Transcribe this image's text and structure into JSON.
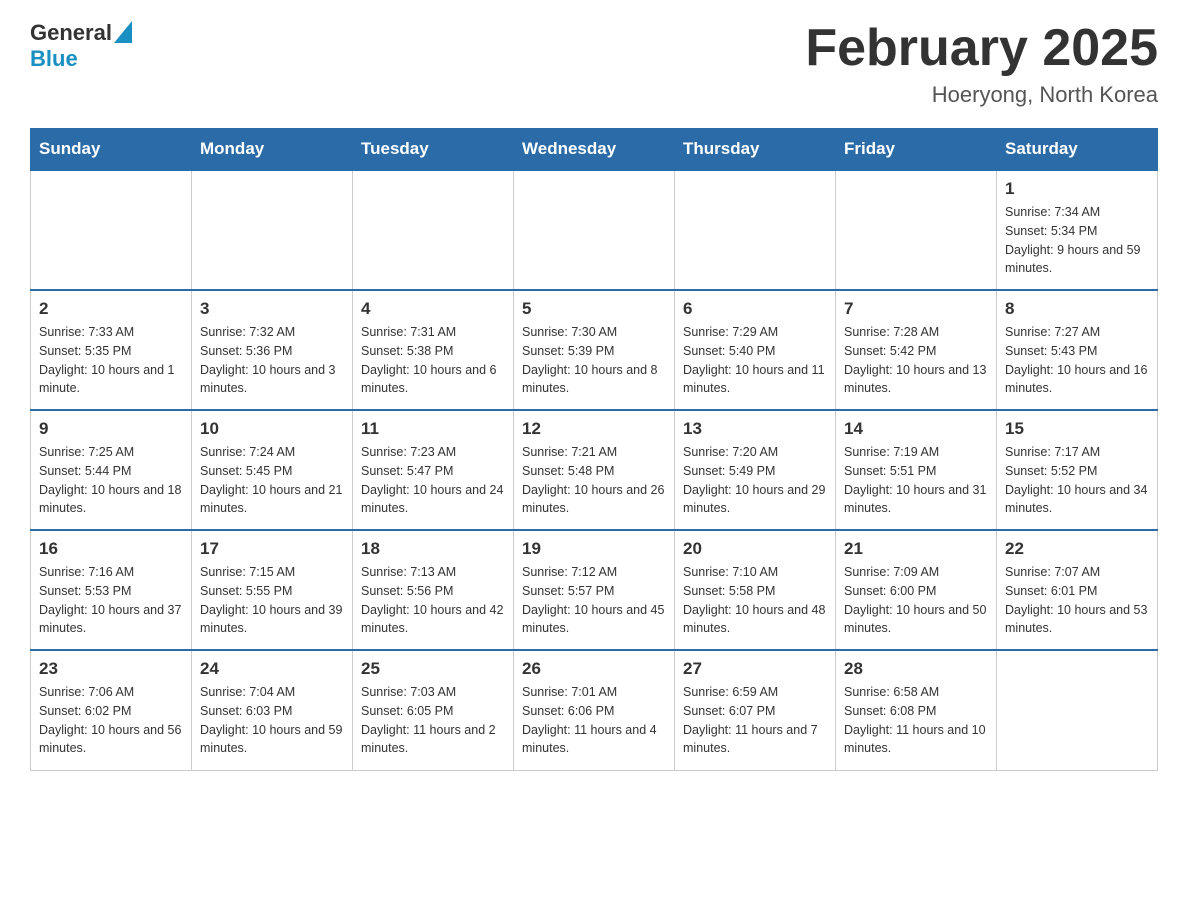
{
  "header": {
    "logo_general": "General",
    "logo_blue": "Blue",
    "title": "February 2025",
    "subtitle": "Hoeryong, North Korea"
  },
  "weekdays": [
    "Sunday",
    "Monday",
    "Tuesday",
    "Wednesday",
    "Thursday",
    "Friday",
    "Saturday"
  ],
  "weeks": [
    [
      {
        "day": "",
        "info": ""
      },
      {
        "day": "",
        "info": ""
      },
      {
        "day": "",
        "info": ""
      },
      {
        "day": "",
        "info": ""
      },
      {
        "day": "",
        "info": ""
      },
      {
        "day": "",
        "info": ""
      },
      {
        "day": "1",
        "info": "Sunrise: 7:34 AM\nSunset: 5:34 PM\nDaylight: 9 hours and 59 minutes."
      }
    ],
    [
      {
        "day": "2",
        "info": "Sunrise: 7:33 AM\nSunset: 5:35 PM\nDaylight: 10 hours and 1 minute."
      },
      {
        "day": "3",
        "info": "Sunrise: 7:32 AM\nSunset: 5:36 PM\nDaylight: 10 hours and 3 minutes."
      },
      {
        "day": "4",
        "info": "Sunrise: 7:31 AM\nSunset: 5:38 PM\nDaylight: 10 hours and 6 minutes."
      },
      {
        "day": "5",
        "info": "Sunrise: 7:30 AM\nSunset: 5:39 PM\nDaylight: 10 hours and 8 minutes."
      },
      {
        "day": "6",
        "info": "Sunrise: 7:29 AM\nSunset: 5:40 PM\nDaylight: 10 hours and 11 minutes."
      },
      {
        "day": "7",
        "info": "Sunrise: 7:28 AM\nSunset: 5:42 PM\nDaylight: 10 hours and 13 minutes."
      },
      {
        "day": "8",
        "info": "Sunrise: 7:27 AM\nSunset: 5:43 PM\nDaylight: 10 hours and 16 minutes."
      }
    ],
    [
      {
        "day": "9",
        "info": "Sunrise: 7:25 AM\nSunset: 5:44 PM\nDaylight: 10 hours and 18 minutes."
      },
      {
        "day": "10",
        "info": "Sunrise: 7:24 AM\nSunset: 5:45 PM\nDaylight: 10 hours and 21 minutes."
      },
      {
        "day": "11",
        "info": "Sunrise: 7:23 AM\nSunset: 5:47 PM\nDaylight: 10 hours and 24 minutes."
      },
      {
        "day": "12",
        "info": "Sunrise: 7:21 AM\nSunset: 5:48 PM\nDaylight: 10 hours and 26 minutes."
      },
      {
        "day": "13",
        "info": "Sunrise: 7:20 AM\nSunset: 5:49 PM\nDaylight: 10 hours and 29 minutes."
      },
      {
        "day": "14",
        "info": "Sunrise: 7:19 AM\nSunset: 5:51 PM\nDaylight: 10 hours and 31 minutes."
      },
      {
        "day": "15",
        "info": "Sunrise: 7:17 AM\nSunset: 5:52 PM\nDaylight: 10 hours and 34 minutes."
      }
    ],
    [
      {
        "day": "16",
        "info": "Sunrise: 7:16 AM\nSunset: 5:53 PM\nDaylight: 10 hours and 37 minutes."
      },
      {
        "day": "17",
        "info": "Sunrise: 7:15 AM\nSunset: 5:55 PM\nDaylight: 10 hours and 39 minutes."
      },
      {
        "day": "18",
        "info": "Sunrise: 7:13 AM\nSunset: 5:56 PM\nDaylight: 10 hours and 42 minutes."
      },
      {
        "day": "19",
        "info": "Sunrise: 7:12 AM\nSunset: 5:57 PM\nDaylight: 10 hours and 45 minutes."
      },
      {
        "day": "20",
        "info": "Sunrise: 7:10 AM\nSunset: 5:58 PM\nDaylight: 10 hours and 48 minutes."
      },
      {
        "day": "21",
        "info": "Sunrise: 7:09 AM\nSunset: 6:00 PM\nDaylight: 10 hours and 50 minutes."
      },
      {
        "day": "22",
        "info": "Sunrise: 7:07 AM\nSunset: 6:01 PM\nDaylight: 10 hours and 53 minutes."
      }
    ],
    [
      {
        "day": "23",
        "info": "Sunrise: 7:06 AM\nSunset: 6:02 PM\nDaylight: 10 hours and 56 minutes."
      },
      {
        "day": "24",
        "info": "Sunrise: 7:04 AM\nSunset: 6:03 PM\nDaylight: 10 hours and 59 minutes."
      },
      {
        "day": "25",
        "info": "Sunrise: 7:03 AM\nSunset: 6:05 PM\nDaylight: 11 hours and 2 minutes."
      },
      {
        "day": "26",
        "info": "Sunrise: 7:01 AM\nSunset: 6:06 PM\nDaylight: 11 hours and 4 minutes."
      },
      {
        "day": "27",
        "info": "Sunrise: 6:59 AM\nSunset: 6:07 PM\nDaylight: 11 hours and 7 minutes."
      },
      {
        "day": "28",
        "info": "Sunrise: 6:58 AM\nSunset: 6:08 PM\nDaylight: 11 hours and 10 minutes."
      },
      {
        "day": "",
        "info": ""
      }
    ]
  ]
}
